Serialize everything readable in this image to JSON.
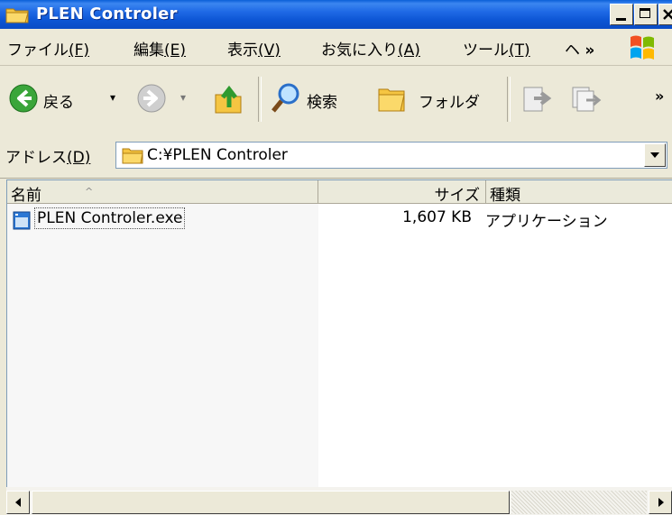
{
  "window": {
    "title": "PLEN Controler"
  },
  "menu": {
    "items": [
      {
        "label": "ファイル",
        "key": "(F)"
      },
      {
        "label": "編集",
        "key": "(E)"
      },
      {
        "label": "表示",
        "key": "(V)"
      },
      {
        "label": "お気に入り",
        "key": "(A)"
      },
      {
        "label": "ツール",
        "key": "(T)"
      },
      {
        "label": "ヘ",
        "key": "»"
      }
    ]
  },
  "toolbar": {
    "back_label": "戻る",
    "search_label": "検索",
    "folders_label": "フォルダ",
    "more": "»"
  },
  "address": {
    "label": "アドレス",
    "key": "(D)",
    "value": "C:¥PLEN Controler"
  },
  "list": {
    "columns": [
      "名前",
      "サイズ",
      "種類"
    ],
    "sort_indicator": "^",
    "rows": [
      {
        "name": "PLEN Controler.exe",
        "size": "1,607 KB",
        "type": "アプリケーション"
      }
    ]
  },
  "colors": {
    "title_bar": "#0a5fd8",
    "window_face": "#ece9d8",
    "list_bg": "#ffffff"
  }
}
